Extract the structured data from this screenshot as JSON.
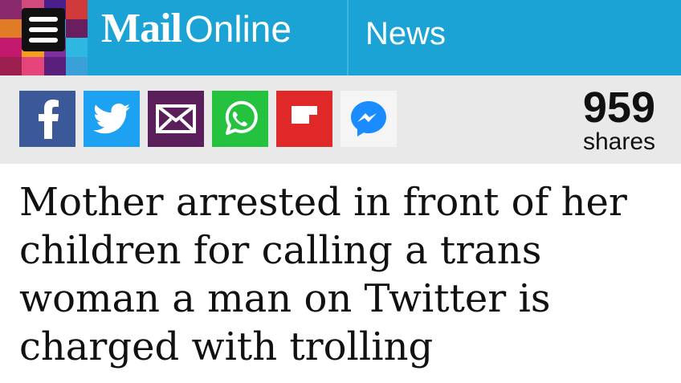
{
  "header": {
    "brand_mail": "Mail",
    "brand_online": "Online",
    "section": "News",
    "menu_icon": "hamburger-menu-icon",
    "colors": {
      "bar": "#1aa3d4",
      "mosaic": [
        "#8a2a6c",
        "#d04a7c",
        "#4a1e8c",
        "#d03a3a",
        "#e07b28",
        "#ad2b76",
        "#2e9fd8",
        "#6b1e5e",
        "#c2186d",
        "#f0a020",
        "#7d2fa0",
        "#2eb7e0",
        "#9c1f4f",
        "#e5457a",
        "#5a1f7a",
        "#3aa0d8"
      ]
    }
  },
  "share": {
    "buttons": [
      {
        "name": "facebook",
        "icon": "facebook-icon",
        "color": "#3b5998"
      },
      {
        "name": "twitter",
        "icon": "twitter-icon",
        "color": "#1da1f2"
      },
      {
        "name": "email",
        "icon": "envelope-icon",
        "color": "#5a1e5a"
      },
      {
        "name": "whatsapp",
        "icon": "whatsapp-icon",
        "color": "#25c240"
      },
      {
        "name": "flipboard",
        "icon": "flipboard-icon",
        "color": "#e12828"
      },
      {
        "name": "messenger",
        "icon": "messenger-icon",
        "color": "#f5f5f5"
      }
    ],
    "count": "959",
    "count_label": "shares"
  },
  "article": {
    "headline": "Mother arrested in front of her children for calling a trans woman a man on Twitter is charged with trolling"
  }
}
